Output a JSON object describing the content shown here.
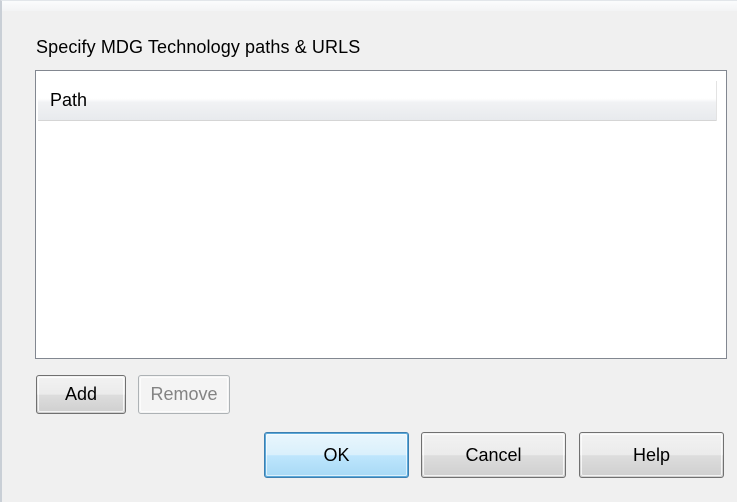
{
  "dialog": {
    "group_label": "Specify MDG Technology paths & URLS",
    "list": {
      "columns": [
        "Path"
      ],
      "rows": []
    },
    "buttons": {
      "add": "Add",
      "remove": "Remove",
      "ok": "OK",
      "cancel": "Cancel",
      "help": "Help"
    },
    "states": {
      "remove_enabled": false,
      "ok_default": true
    },
    "colors": {
      "background": "#f0f0f0",
      "list_background": "#ffffff",
      "list_border": "#828790",
      "default_button_border": "#3c7fb1",
      "disabled_text": "#838383"
    }
  }
}
